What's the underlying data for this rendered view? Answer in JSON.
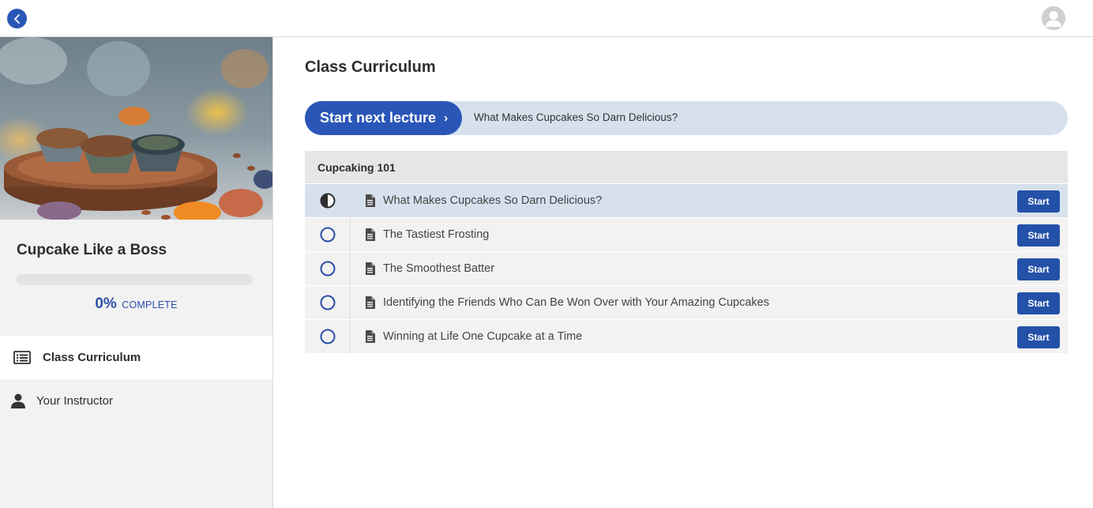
{
  "topbar": {
    "back_icon": "chevron-left-icon",
    "avatar_icon": "user-avatar-icon"
  },
  "sidebar": {
    "course_title": "Cupcake Like a Boss",
    "progress_value": 0,
    "progress_percent": "0%",
    "progress_label": "COMPLETE",
    "nav": [
      {
        "label": "Class Curriculum",
        "icon": "list-icon",
        "active": true
      },
      {
        "label": "Your Instructor",
        "icon": "person-icon",
        "active": false
      }
    ]
  },
  "main": {
    "title": "Class Curriculum",
    "next_lecture": {
      "button_label": "Start next lecture",
      "chevron": "›",
      "lecture_title": "What Makes Cupcakes So Darn Delicious?"
    },
    "section": {
      "title": "Cupcaking 101",
      "lectures": [
        {
          "title": "What Makes Cupcakes So Darn Delicious?",
          "status": "in-progress",
          "action": "Start"
        },
        {
          "title": "The Tastiest Frosting",
          "status": "not-started",
          "action": "Start"
        },
        {
          "title": "The Smoothest Batter",
          "status": "not-started",
          "action": "Start"
        },
        {
          "title": "Identifying the Friends Who Can Be Won Over with Your Amazing Cupcakes",
          "status": "not-started",
          "action": "Start"
        },
        {
          "title": "Winning at Life One Cupcake at a Time",
          "status": "not-started",
          "action": "Start"
        }
      ]
    }
  },
  "colors": {
    "accent": "#2a56b8",
    "current_row": "#d7e1ee",
    "row": "#f2f2f2"
  }
}
